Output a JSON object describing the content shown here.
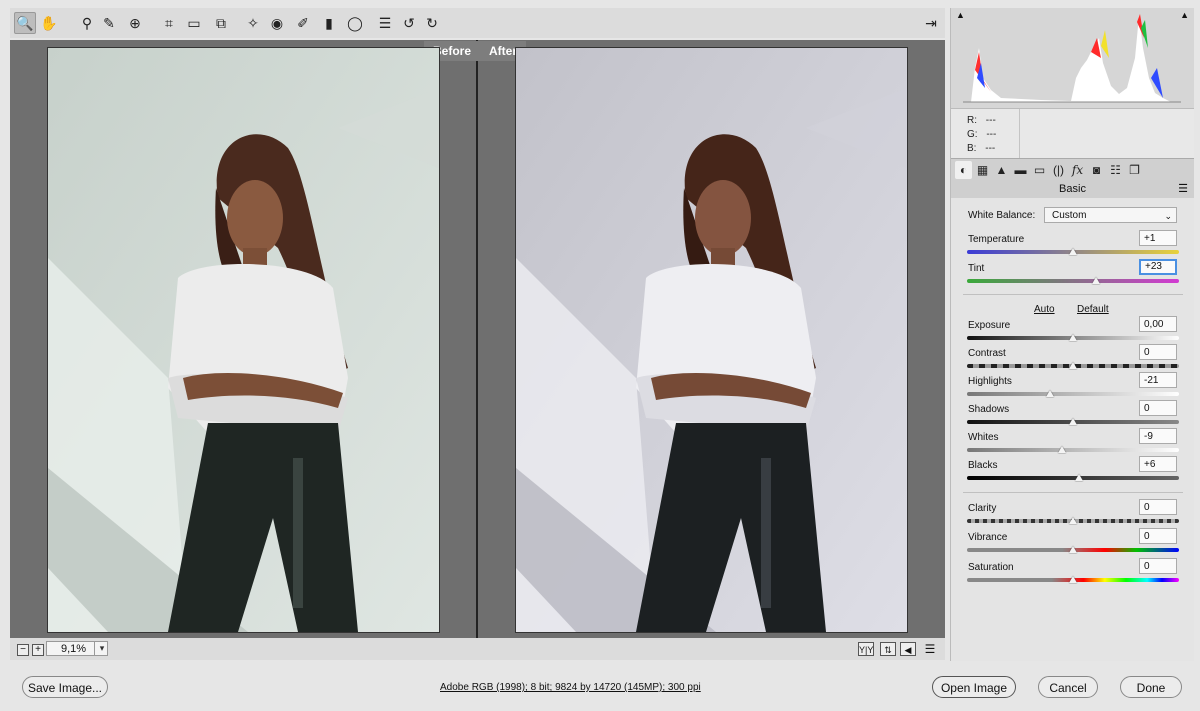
{
  "preview": {
    "before_label": "Before",
    "after_label": "After"
  },
  "toolbar": {
    "tools": [
      {
        "name": "zoom-tool-icon",
        "glyph": "🔍"
      },
      {
        "name": "hand-tool-icon",
        "glyph": "✋"
      },
      {
        "name": "white-balance-tool-icon",
        "glyph": "⚲"
      },
      {
        "name": "color-sampler-icon",
        "glyph": "✎"
      },
      {
        "name": "targeted-adjustment-icon",
        "glyph": "⊕"
      },
      {
        "name": "crop-tool-icon",
        "glyph": "⌗"
      },
      {
        "name": "straighten-tool-icon",
        "glyph": "▭"
      },
      {
        "name": "transform-tool-icon",
        "glyph": "⧉"
      },
      {
        "name": "spot-removal-icon",
        "glyph": "✧"
      },
      {
        "name": "red-eye-icon",
        "glyph": "◉"
      },
      {
        "name": "adjustment-brush-icon",
        "glyph": "✐"
      },
      {
        "name": "graduated-filter-icon",
        "glyph": "▮"
      },
      {
        "name": "radial-filter-icon",
        "glyph": "◯"
      },
      {
        "name": "preferences-icon",
        "glyph": "☰"
      },
      {
        "name": "rotate-left-icon",
        "glyph": "↺"
      },
      {
        "name": "rotate-right-icon",
        "glyph": "↻"
      }
    ],
    "fullscreen_glyph": "⇥"
  },
  "statusbar": {
    "zoom_value": "9,1%",
    "zoom_out": "−",
    "zoom_in": "+"
  },
  "histogram": {
    "readout": [
      {
        "channel": "R:",
        "value": "---"
      },
      {
        "channel": "G:",
        "value": "---"
      },
      {
        "channel": "B:",
        "value": "---"
      }
    ]
  },
  "panel": {
    "section_title": "Basic",
    "tabs": [
      {
        "name": "basic-tab-icon",
        "glyph": "◐"
      },
      {
        "name": "tone-curve-tab-icon",
        "glyph": "▦"
      },
      {
        "name": "detail-tab-icon",
        "glyph": "▲"
      },
      {
        "name": "hsl-tab-icon",
        "glyph": "▬"
      },
      {
        "name": "split-toning-tab-icon",
        "glyph": "▭"
      },
      {
        "name": "lens-corrections-tab-icon",
        "glyph": "(|)"
      },
      {
        "name": "effects-tab-icon",
        "glyph": "fx"
      },
      {
        "name": "camera-calibration-tab-icon",
        "glyph": "◙"
      },
      {
        "name": "presets-tab-icon",
        "glyph": "☷"
      },
      {
        "name": "snapshots-tab-icon",
        "glyph": "❐"
      }
    ],
    "white_balance": {
      "label": "White Balance:",
      "value": "Custom"
    },
    "auto_label": "Auto",
    "default_label": "Default",
    "sliders": [
      {
        "id": "temperature",
        "label": "Temperature",
        "value": "+1",
        "position": 0.5
      },
      {
        "id": "tint",
        "label": "Tint",
        "value": "+23",
        "position": 0.61
      },
      {
        "id": "exposure",
        "label": "Exposure",
        "value": "0,00",
        "position": 0.5
      },
      {
        "id": "contrast",
        "label": "Contrast",
        "value": "0",
        "position": 0.5
      },
      {
        "id": "highlights",
        "label": "Highlights",
        "value": "-21",
        "position": 0.39
      },
      {
        "id": "shadows",
        "label": "Shadows",
        "value": "0",
        "position": 0.5
      },
      {
        "id": "whites",
        "label": "Whites",
        "value": "-9",
        "position": 0.45
      },
      {
        "id": "blacks",
        "label": "Blacks",
        "value": "+6",
        "position": 0.53
      },
      {
        "id": "clarity",
        "label": "Clarity",
        "value": "0",
        "position": 0.5
      },
      {
        "id": "vibrance",
        "label": "Vibrance",
        "value": "0",
        "position": 0.5
      },
      {
        "id": "saturation",
        "label": "Saturation",
        "value": "0",
        "position": 0.5
      }
    ]
  },
  "footer": {
    "save_label": "Save Image...",
    "info": "Adobe RGB (1998); 8 bit; 9824 by 14720 (145MP); 300 ppi",
    "open_label": "Open Image",
    "cancel_label": "Cancel",
    "done_label": "Done"
  },
  "colors": {
    "temperature_gradient": [
      "#3b3bd6",
      "#e8d23a"
    ],
    "tint_gradient": [
      "#3aa93a",
      "#d23ad2"
    ],
    "vibrance_gradient": [
      "#808080",
      "#ff0000",
      "#00ff00",
      "#0000ff"
    ]
  }
}
